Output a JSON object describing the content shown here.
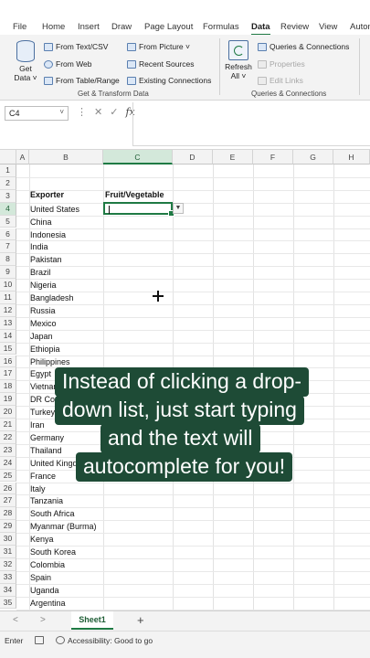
{
  "menu": {
    "tabs": [
      {
        "label": "File"
      },
      {
        "label": "Home"
      },
      {
        "label": "Insert"
      },
      {
        "label": "Draw"
      },
      {
        "label": "Page Layout"
      },
      {
        "label": "Formulas"
      },
      {
        "label": "Data",
        "active": true
      },
      {
        "label": "Review"
      },
      {
        "label": "View"
      },
      {
        "label": "Autom"
      }
    ]
  },
  "ribbon": {
    "get_data": {
      "line1": "Get",
      "line2": "Data ˅"
    },
    "from_text_csv": "From Text/CSV",
    "from_web": "From Web",
    "from_table_range": "From Table/Range",
    "from_picture": "From Picture ˅",
    "recent_sources": "Recent Sources",
    "existing_connections": "Existing Connections",
    "group_get_transform": "Get & Transform Data",
    "refresh": {
      "line1": "Refresh",
      "line2": "All ˅"
    },
    "queries_connections": "Queries & Connections",
    "properties": "Properties",
    "edit_links": "Edit Links",
    "group_queries": "Queries & Connections"
  },
  "formula_bar": {
    "name_box": "C4",
    "name_box_arrow": "˅",
    "more": "⋮",
    "cancel": "✕",
    "enter": "✓",
    "fx": "fx",
    "value": ""
  },
  "grid": {
    "columns": [
      "A",
      "B",
      "C",
      "D",
      "E",
      "F",
      "G",
      "H"
    ],
    "rows": [
      "1",
      "2",
      "3",
      "4",
      "5",
      "6",
      "7",
      "8",
      "9",
      "10",
      "11",
      "12",
      "13",
      "14",
      "15",
      "16",
      "17",
      "18",
      "19",
      "20",
      "21",
      "22",
      "23",
      "24",
      "25",
      "26",
      "27",
      "28",
      "29",
      "30",
      "31",
      "32",
      "33",
      "34",
      "35"
    ],
    "header_exporter": "Exporter",
    "header_fruit": "Fruit/Vegetable",
    "dropdown_arrow": "▼",
    "countries": [
      "United States",
      "China",
      "Indonesia",
      "India",
      "Pakistan",
      "Brazil",
      "Nigeria",
      "Bangladesh",
      "Russia",
      "Mexico",
      "Japan",
      "Ethiopia",
      "Philippines",
      "Egypt",
      "Vietnam",
      "DR Congo",
      "Turkey",
      "Iran",
      "Germany",
      "Thailand",
      "United Kingdom",
      "France",
      "Italy",
      "Tanzania",
      "South Africa",
      "Myanmar (Burma)",
      "Kenya",
      "South Korea",
      "Colombia",
      "Spain",
      "Uganda",
      "Argentina"
    ]
  },
  "caption": {
    "line1": "Instead of clicking a drop-",
    "line2": "down list, just start typing",
    "line3": "and the text will",
    "line4": "autocomplete for you!"
  },
  "sheets": {
    "nav_prev": "<",
    "nav_next": ">",
    "active": "Sheet1",
    "add": "+"
  },
  "status": {
    "mode": "Enter",
    "accessibility": "Accessibility: Good to go"
  }
}
